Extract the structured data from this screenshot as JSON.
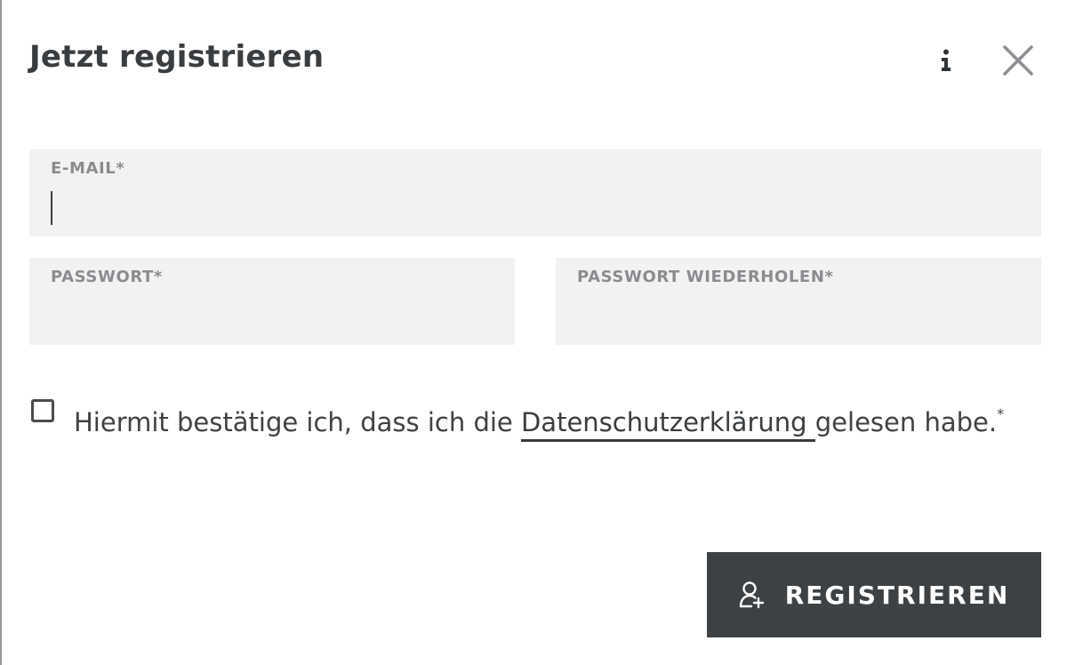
{
  "dialog": {
    "title": "Jetzt registrieren",
    "info_icon": "info-icon",
    "close_icon": "close-icon"
  },
  "form": {
    "email": {
      "label": "E-MAIL*",
      "value": ""
    },
    "password": {
      "label": "PASSWORT*",
      "value": ""
    },
    "password_repeat": {
      "label": "PASSWORT WIEDERHOLEN*",
      "value": ""
    }
  },
  "consent": {
    "checked": false,
    "text_before": "Hiermit bestätige ich, dass ich die ",
    "link_text": "Datenschutzerklärung ",
    "text_after": "gelesen habe.",
    "required_mark": "*"
  },
  "submit": {
    "label": "REGISTRIEREN",
    "icon": "add-user-icon"
  },
  "colors": {
    "button_bg": "#3e4144",
    "field_bg": "#f2f2f3",
    "text": "#3f4245",
    "label": "#8a8c8f"
  }
}
